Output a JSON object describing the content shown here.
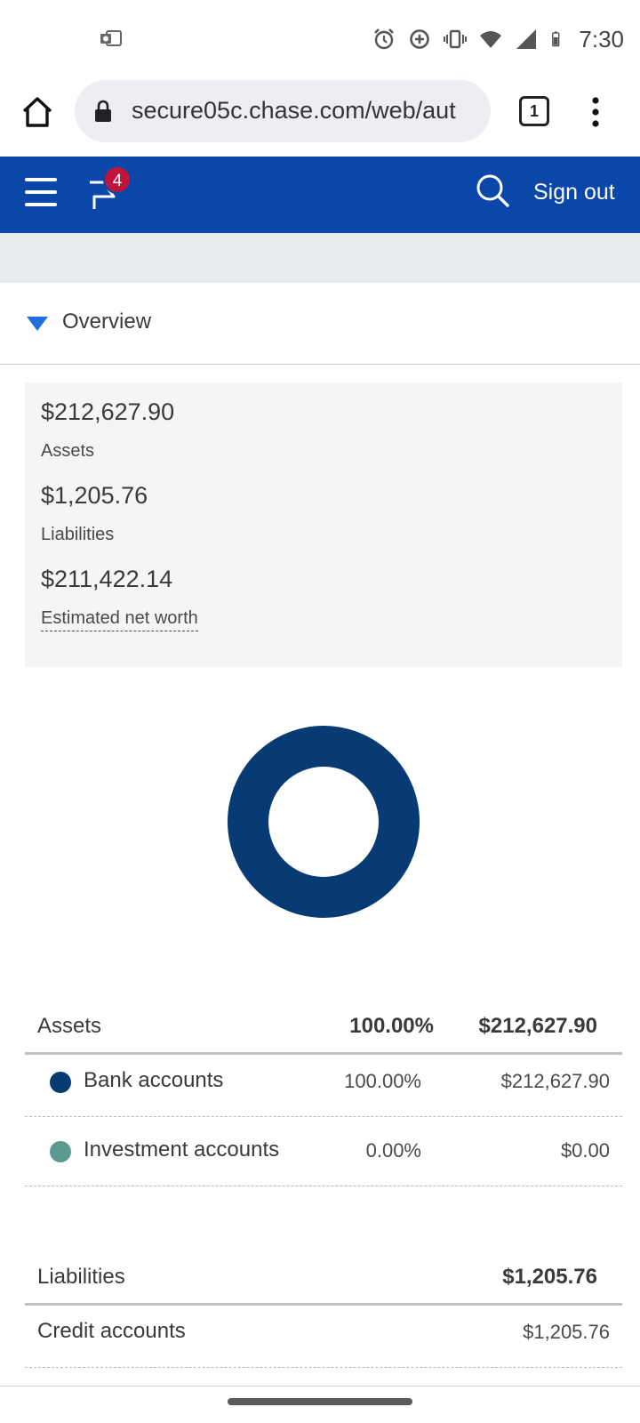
{
  "status_bar": {
    "time": "7:30",
    "left_icon": "outlook-notification-icon",
    "icons": [
      "alarm-icon",
      "data-saver-icon",
      "vibrate-icon",
      "wifi-icon",
      "signal-icon",
      "battery-icon"
    ]
  },
  "browser": {
    "url": "secure05c.chase.com/web/aut",
    "tab_count": "1"
  },
  "header": {
    "notification_count": "4",
    "sign_out_label": "Sign out",
    "brand_color": "#0b47a8"
  },
  "overview": {
    "title": "Overview"
  },
  "summary": {
    "assets_amount": "$212,627.90",
    "assets_label": "Assets",
    "liabilities_amount": "$1,205.76",
    "liabilities_label": "Liabilities",
    "net_worth_amount": "$211,422.14",
    "net_worth_label": "Estimated net worth"
  },
  "chart_data": {
    "type": "pie",
    "categories": [
      "Bank accounts",
      "Investment accounts"
    ],
    "values": [
      100.0,
      0.0
    ],
    "colors": [
      "#083a73",
      "#5c9a8d"
    ]
  },
  "assets_table": {
    "header": {
      "label": "Assets",
      "percent": "100.00%",
      "total": "$212,627.90"
    },
    "rows": [
      {
        "name": "Bank accounts",
        "percent": "100.00%",
        "value": "$212,627.90",
        "color": "#083a73"
      },
      {
        "name": "Investment accounts",
        "percent": "0.00%",
        "value": "$0.00",
        "color": "#5c9a8d"
      }
    ]
  },
  "liabilities_table": {
    "header": {
      "label": "Liabilities",
      "total": "$1,205.76"
    },
    "rows": [
      {
        "name": "Credit accounts",
        "value": "$1,205.76"
      }
    ]
  }
}
